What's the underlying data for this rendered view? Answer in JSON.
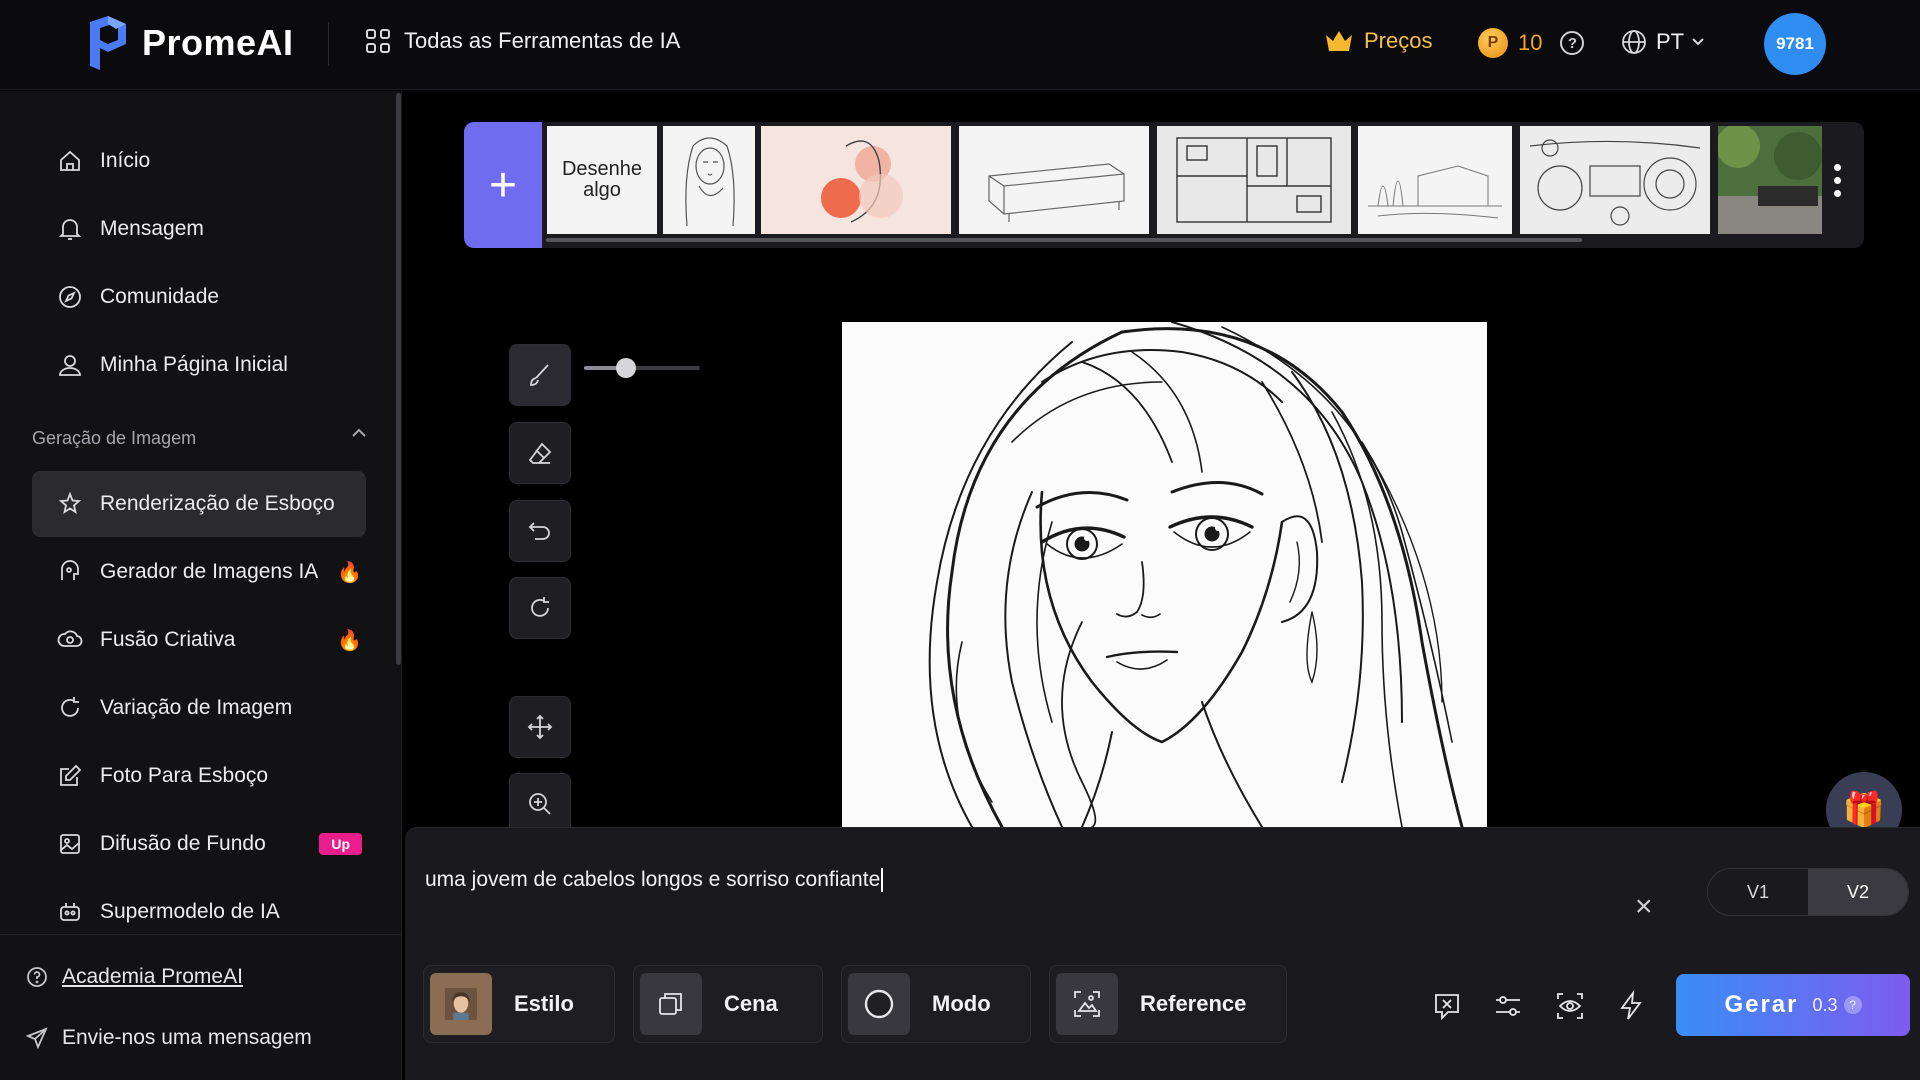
{
  "app": {
    "name": "PromeAI"
  },
  "header": {
    "all_tools": "Todas as Ferramentas de IA",
    "pricing": "Preços",
    "credits": "10",
    "coin_symbol": "P",
    "help": "?",
    "language": "PT",
    "avatar": "9781"
  },
  "sidebar": {
    "items": [
      {
        "label": "Início",
        "icon": "home-icon"
      },
      {
        "label": "Mensagem",
        "icon": "bell-icon"
      },
      {
        "label": "Comunidade",
        "icon": "compass-icon"
      },
      {
        "label": "Minha Página Inicial",
        "icon": "user-icon"
      }
    ],
    "section_title": "Geração de Imagem",
    "section_items": [
      {
        "label": "Renderização de Esboço",
        "icon": "sketch-render-icon",
        "active": true
      },
      {
        "label": "Gerador de Imagens IA",
        "icon": "ai-image-icon",
        "hot": true
      },
      {
        "label": "Fusão Criativa",
        "icon": "fusion-icon",
        "hot": true
      },
      {
        "label": "Variação de Imagem",
        "icon": "refresh-icon"
      },
      {
        "label": "Foto Para Esboço",
        "icon": "edit-icon"
      },
      {
        "label": "Difusão de Fundo",
        "icon": "image-icon",
        "badge": "Up"
      },
      {
        "label": "Supermodelo de IA",
        "icon": "robot-icon"
      }
    ],
    "academy": "Academia PromeAI",
    "contact": "Envie-nos uma mensagem"
  },
  "templates": {
    "add": "+",
    "draw_label": "Desenhe algo"
  },
  "prompt": {
    "text": "uma jovem de cabelos longos e sorriso confiante",
    "clear": "×",
    "versions": [
      "V1",
      "V2"
    ],
    "active_version": "V2",
    "options": [
      "Estilo",
      "Cena",
      "Modo",
      "Reference"
    ],
    "generate": "Gerar",
    "cost": "0.3",
    "cost_help": "?"
  },
  "brush_size_fraction": 0.36,
  "colors": {
    "accent": "#6f6cf0",
    "avatar": "#2f8cf0",
    "pricing": "#f5c04a",
    "badge": "#e91e8c",
    "generate_start": "#3a8df5",
    "generate_end": "#7d5cf0"
  }
}
